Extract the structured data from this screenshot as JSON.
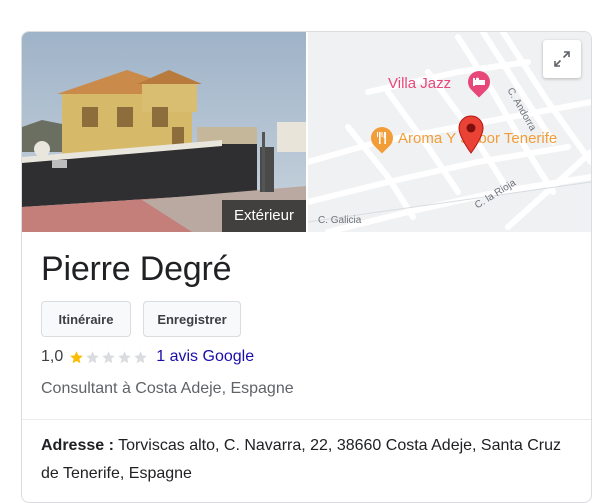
{
  "place": {
    "name": "Pierre Degré",
    "photo_label": "Extérieur",
    "actions": {
      "directions": "Itinéraire",
      "save": "Enregistrer"
    },
    "rating": {
      "value_text": "1,0",
      "value": 1.0,
      "max": 5,
      "reviews_text": "1 avis Google"
    },
    "category": "Consultant à Costa Adeje, Espagne",
    "address_label": "Adresse :",
    "address_value": "Torviscas alto, C. Navarra, 22, 38660 Costa Adeje, Santa Cruz de Tenerife, Espagne"
  },
  "map": {
    "labels": {
      "hotel": "Villa Jazz",
      "restaurant": "Aroma Y Sabor Tenerife",
      "street_1": "C. Andorra",
      "street_2": "C. la Rioja",
      "street_3": "C. Galicia"
    },
    "icons": [
      "hotel-icon",
      "restaurant-icon",
      "map-pin-icon",
      "expand-icon"
    ]
  },
  "colors": {
    "star_filled": "#fbbc04",
    "star_empty": "#dadce0",
    "link": "#1a0dab",
    "hotel_pink": "#e8477a",
    "restaurant_orange": "#f29d38",
    "pin_red": "#ea4335"
  }
}
